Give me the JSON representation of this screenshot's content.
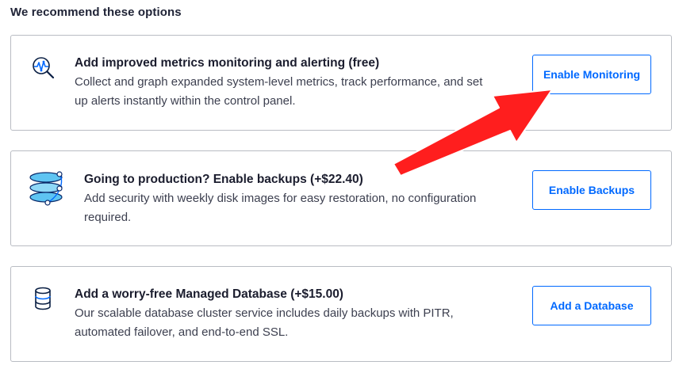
{
  "section_title": "We recommend these options",
  "options": [
    {
      "title": "Add improved metrics monitoring and alerting (free)",
      "description": "Collect and graph expanded system-level metrics, track performance, and set up alerts instantly within the control panel.",
      "button_label": "Enable Monitoring",
      "icon": "monitoring-icon"
    },
    {
      "title": "Going to production? Enable backups (+$22.40)",
      "description": "Add security with weekly disk images for easy restoration, no configuration required.",
      "button_label": "Enable Backups",
      "icon": "backups-icon"
    },
    {
      "title": "Add a worry-free Managed Database (+$15.00)",
      "description": "Our scalable database cluster service includes daily backups with PITR, automated failover, and end-to-end SSL.",
      "button_label": "Add a Database",
      "icon": "database-icon"
    }
  ],
  "colors": {
    "accent": "#0069ff",
    "annotation_arrow": "#ff1e1e",
    "border": "#b9bcc3",
    "title_text": "#1b1d2e"
  }
}
